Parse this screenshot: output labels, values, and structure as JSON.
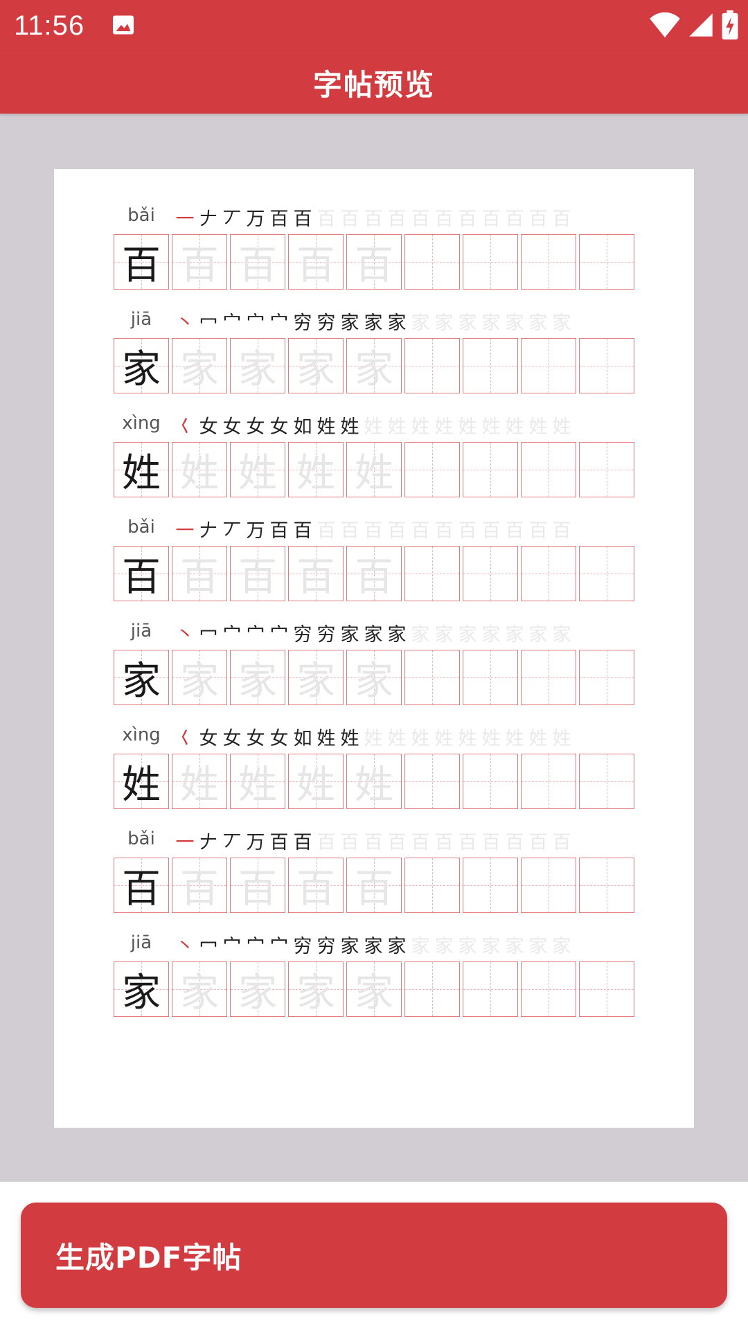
{
  "status_bar": {
    "time": "11:56"
  },
  "app_bar": {
    "title": "字帖预览"
  },
  "rows": [
    {
      "pinyin": "bǎi",
      "char": "百",
      "strokes": [
        "一",
        "𠂇",
        "丆",
        "万",
        "百",
        "百"
      ],
      "trailing_count": 11
    },
    {
      "pinyin": "jiā",
      "char": "家",
      "strokes": [
        "丶",
        "冖",
        "宀",
        "宀",
        "宀",
        "穷",
        "穷",
        "家",
        "家",
        "家"
      ],
      "trailing_count": 7
    },
    {
      "pinyin": "xìng",
      "char": "姓",
      "strokes": [
        "𡿨",
        "女",
        "女",
        "女",
        "女",
        "如",
        "姓",
        "姓"
      ],
      "trailing_count": 9
    },
    {
      "pinyin": "bǎi",
      "char": "百",
      "strokes": [
        "一",
        "𠂇",
        "丆",
        "万",
        "百",
        "百"
      ],
      "trailing_count": 11
    },
    {
      "pinyin": "jiā",
      "char": "家",
      "strokes": [
        "丶",
        "冖",
        "宀",
        "宀",
        "宀",
        "穷",
        "穷",
        "家",
        "家",
        "家"
      ],
      "trailing_count": 7
    },
    {
      "pinyin": "xìng",
      "char": "姓",
      "strokes": [
        "𡿨",
        "女",
        "女",
        "女",
        "女",
        "如",
        "姓",
        "姓"
      ],
      "trailing_count": 9
    },
    {
      "pinyin": "bǎi",
      "char": "百",
      "strokes": [
        "一",
        "𠂇",
        "丆",
        "万",
        "百",
        "百"
      ],
      "trailing_count": 11
    },
    {
      "pinyin": "jiā",
      "char": "家",
      "strokes": [
        "丶",
        "冖",
        "宀",
        "宀",
        "宀",
        "穷",
        "穷",
        "家",
        "家",
        "家"
      ],
      "trailing_count": 7
    }
  ],
  "grid": {
    "trace_cells": 4,
    "empty_cells": 4
  },
  "bottom": {
    "button_label": "生成PDF字帖"
  },
  "colors": {
    "accent": "#d23c41",
    "grid_line": "#e07a7e"
  },
  "icons": {
    "status_image": "image-icon",
    "wifi": "wifi-icon",
    "signal": "signal-icon",
    "battery": "battery-charging-icon"
  }
}
